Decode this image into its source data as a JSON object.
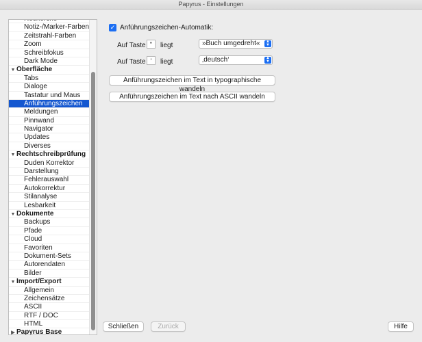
{
  "window": {
    "title": "Papyrus - Einstellungen"
  },
  "sidebar": {
    "rows": [
      {
        "type": "item",
        "label": "Recherche"
      },
      {
        "type": "item",
        "label": "Notiz-/Marker-Farben"
      },
      {
        "type": "item",
        "label": "Zeitstrahl-Farben"
      },
      {
        "type": "item",
        "label": "Zoom"
      },
      {
        "type": "item",
        "label": "Schreibfokus"
      },
      {
        "type": "item",
        "label": "Dark Mode"
      },
      {
        "type": "group",
        "label": "Oberfläche",
        "expanded": true
      },
      {
        "type": "item",
        "label": "Tabs"
      },
      {
        "type": "item",
        "label": "Dialoge"
      },
      {
        "type": "item",
        "label": "Tastatur und Maus"
      },
      {
        "type": "item",
        "label": "Anführungszeichen",
        "selected": true
      },
      {
        "type": "item",
        "label": "Meldungen"
      },
      {
        "type": "item",
        "label": "Pinnwand"
      },
      {
        "type": "item",
        "label": "Navigator"
      },
      {
        "type": "item",
        "label": "Updates"
      },
      {
        "type": "item",
        "label": "Diverses"
      },
      {
        "type": "group",
        "label": "Rechtschreibprüfung",
        "expanded": true
      },
      {
        "type": "item",
        "label": "Duden Korrektor"
      },
      {
        "type": "item",
        "label": "Darstellung"
      },
      {
        "type": "item",
        "label": "Fehlerauswahl"
      },
      {
        "type": "item",
        "label": "Autokorrektur"
      },
      {
        "type": "item",
        "label": "Stilanalyse"
      },
      {
        "type": "item",
        "label": "Lesbarkeit"
      },
      {
        "type": "group",
        "label": "Dokumente",
        "expanded": true
      },
      {
        "type": "item",
        "label": "Backups"
      },
      {
        "type": "item",
        "label": "Pfade"
      },
      {
        "type": "item",
        "label": "Cloud"
      },
      {
        "type": "item",
        "label": "Favoriten"
      },
      {
        "type": "item",
        "label": "Dokument-Sets"
      },
      {
        "type": "item",
        "label": "Autorendaten"
      },
      {
        "type": "item",
        "label": "Bilder"
      },
      {
        "type": "group",
        "label": "Import/Export",
        "expanded": true
      },
      {
        "type": "item",
        "label": "Allgemein"
      },
      {
        "type": "item",
        "label": "Zeichensätze"
      },
      {
        "type": "item",
        "label": "ASCII"
      },
      {
        "type": "item",
        "label": "RTF / DOC"
      },
      {
        "type": "item",
        "label": "HTML"
      },
      {
        "type": "group",
        "label": "Papyrus Base",
        "expanded": false
      }
    ]
  },
  "quotes": {
    "auto_label": "Anführungszeichen-Automatik:",
    "auto_checked": true,
    "row1": {
      "label": "Auf Taste",
      "key": "\"",
      "liegt": "liegt",
      "value": "»Buch umgedreht«"
    },
    "row2": {
      "label": "Auf Taste",
      "key": "'",
      "liegt": "liegt",
      "value": "‚deutsch‘"
    },
    "btn_typographic": "Anführungszeichen im Text in typographische wandeln",
    "btn_ascii": "Anführungszeichen im Text nach ASCII wandeln"
  },
  "footer": {
    "close": "Schließen",
    "back": "Zurück",
    "help": "Hilfe"
  },
  "colors": {
    "accent": "#1c6ef2",
    "selection": "#1457d0"
  }
}
